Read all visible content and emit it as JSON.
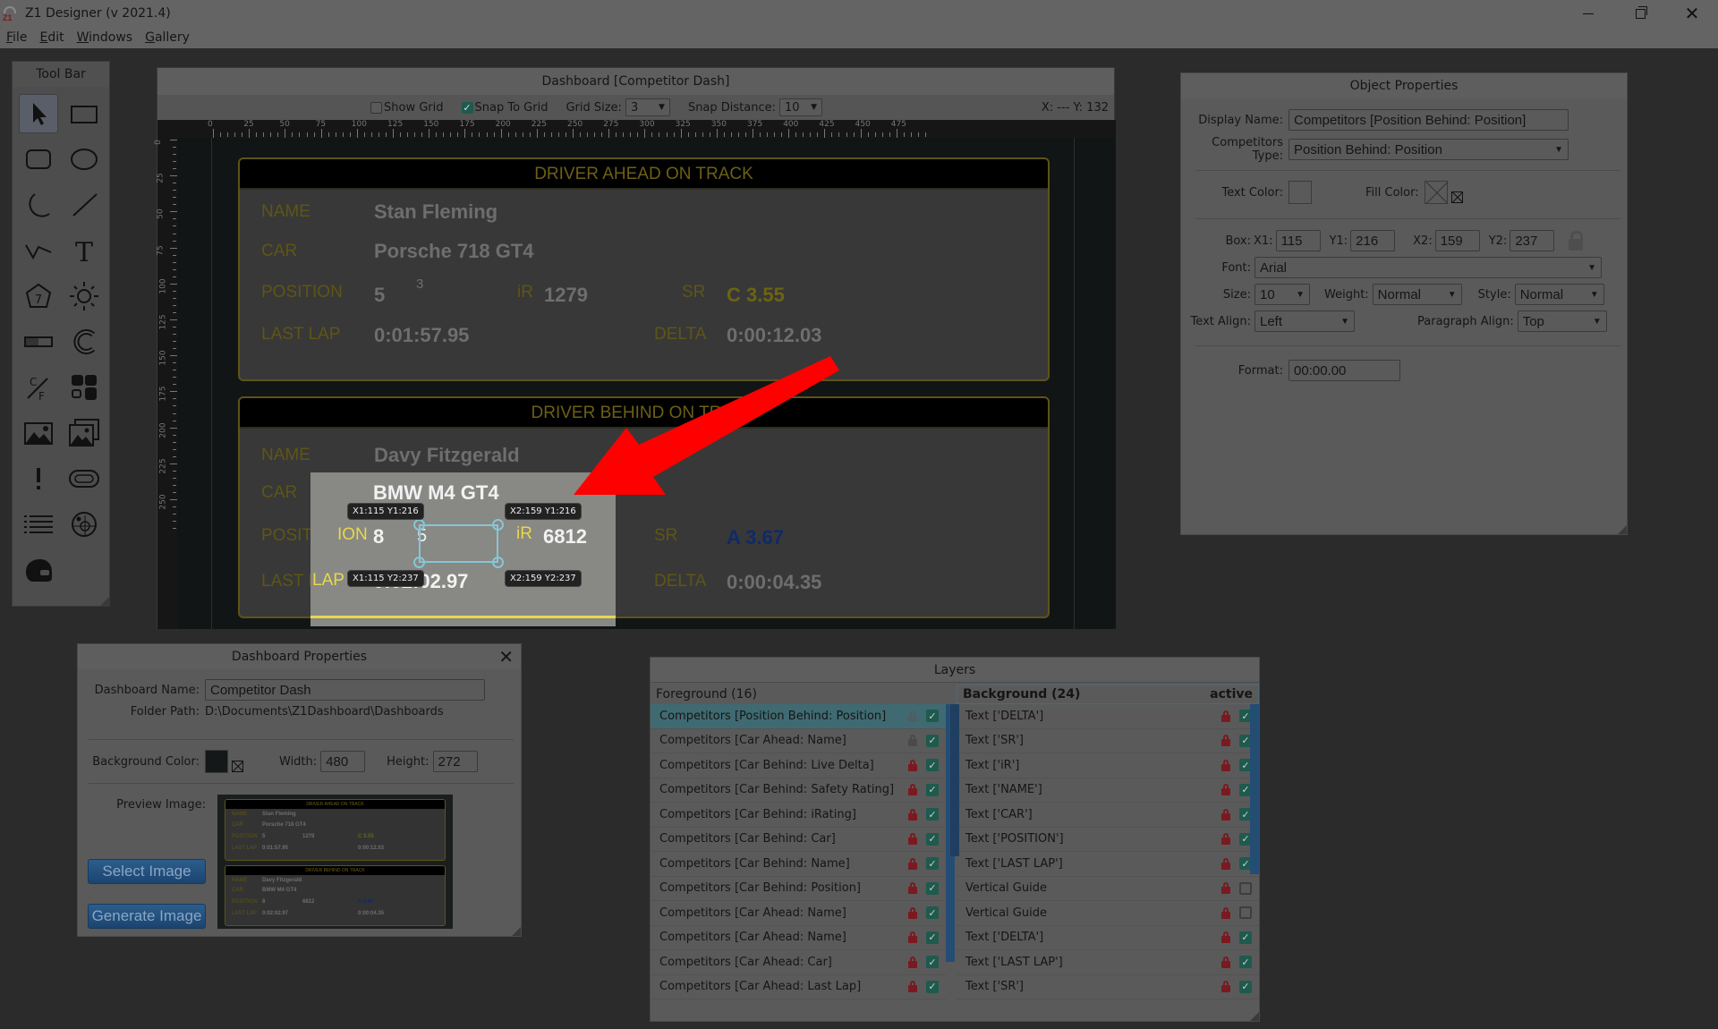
{
  "window": {
    "title": "Z1 Designer (v 2021.4)",
    "controls": [
      "minimize-icon",
      "restore-icon",
      "close-icon"
    ]
  },
  "menu": [
    {
      "label": "File",
      "accel": "F",
      "rest": "ile"
    },
    {
      "label": "Edit",
      "accel": "E",
      "rest": "dit"
    },
    {
      "label": "Windows",
      "accel": "W",
      "rest": "indows"
    },
    {
      "label": "Gallery",
      "accel": "G",
      "rest": "allery"
    }
  ],
  "toolbar": {
    "title": "Tool Bar",
    "tools": [
      "select",
      "rectangle",
      "rounded-rectangle",
      "ellipse",
      "arc",
      "line",
      "polyline",
      "text",
      "gear-indicator",
      "shift-light",
      "bar-gauge",
      "radial-gauge",
      "unit-converter",
      "widget-group",
      "image",
      "image-set",
      "alert",
      "track-map",
      "list",
      "target",
      "helmet"
    ],
    "selected": "select"
  },
  "editor": {
    "title": "Dashboard [Competitor Dash]",
    "show_grid_label": "Show Grid",
    "show_grid": false,
    "snap_to_grid_label": "Snap To Grid",
    "snap_to_grid": true,
    "grid_size_label": "Grid Size:",
    "grid_size": "3",
    "snap_distance_label": "Snap Distance:",
    "snap_distance": "10",
    "coords": "X: --- Y: 132",
    "ruler_x": [
      "0",
      "25",
      "50",
      "75",
      "100",
      "125",
      "150",
      "175",
      "200",
      "225",
      "250",
      "275",
      "300",
      "325",
      "350",
      "375",
      "400",
      "425",
      "450",
      "475"
    ],
    "ruler_y": [
      "0",
      "25",
      "50",
      "75",
      "100",
      "125",
      "150",
      "175",
      "200",
      "225",
      "250"
    ]
  },
  "dashboard": {
    "ahead": {
      "header": "DRIVER AHEAD ON TRACK",
      "name_label": "NAME",
      "name": "Stan Fleming",
      "car_label": "CAR",
      "car": "Porsche 718 GT4",
      "position_label": "POSITION",
      "position": "5",
      "position_class": "3",
      "ir_label": "iR",
      "ir": "1279",
      "sr_label": "SR",
      "sr": "C 3.55",
      "lastlap_label": "LAST LAP",
      "lastlap": "0:01:57.95",
      "delta_label": "DELTA",
      "delta": "0:00:12.03"
    },
    "behind": {
      "header": "DRIVER BEHIND ON TRACK",
      "name_label": "NAME",
      "name": "Davy Fitzgerald",
      "car_label": "CAR",
      "car": "BMW M4 GT4",
      "position_label": "POSITION",
      "position": "8",
      "position_class": "5",
      "ir_label": "iR",
      "ir": "6812",
      "sr_label": "SR",
      "sr": "A 3.67",
      "lastlap_label": "LAST LAP",
      "lastlap": "0:02:02.97",
      "delta_label": "DELTA",
      "delta": "0:00:04.35"
    },
    "selection_tips": {
      "tl": "X1:115 Y1:216",
      "tr": "X2:159 Y1:216",
      "bl": "X1:115 Y2:237",
      "br": "X2:159 Y2:237"
    }
  },
  "object_properties": {
    "title": "Object Properties",
    "display_name_label": "Display Name:",
    "display_name": "Competitors [Position Behind: Position]",
    "competitors_type_label": "Competitors Type:",
    "competitors_type": "Position Behind: Position",
    "text_color_label": "Text Color:",
    "fill_color_label": "Fill Color:",
    "box_label": "Box:",
    "x1_label": "X1:",
    "x1": "115",
    "y1_label": "Y1:",
    "y1": "216",
    "x2_label": "X2:",
    "x2": "159",
    "y2_label": "Y2:",
    "y2": "237",
    "font_label": "Font:",
    "font": "Arial",
    "size_label": "Size:",
    "size": "10",
    "weight_label": "Weight:",
    "weight": "Normal",
    "style_label": "Style:",
    "style": "Normal",
    "text_align_label": "Text Align:",
    "text_align": "Left",
    "paragraph_align_label": "Paragraph Align:",
    "paragraph_align": "Top",
    "format_label": "Format:",
    "format": "00:00.00"
  },
  "dashboard_properties": {
    "title": "Dashboard Properties",
    "name_label": "Dashboard Name:",
    "name": "Competitor Dash",
    "folder_label": "Folder Path:",
    "folder": "D:\\Documents\\Z1Dashboard\\Dashboards",
    "bg_color_label": "Background Color:",
    "bg_color": "#151819",
    "width_label": "Width:",
    "width": "480",
    "height_label": "Height:",
    "height": "272",
    "preview_label": "Preview Image:",
    "select_image": "Select Image",
    "generate_image": "Generate Image"
  },
  "layers": {
    "title": "Layers",
    "foreground": {
      "label": "Foreground (16)",
      "items": [
        {
          "label": "Competitors [Position Behind: Position]",
          "locked": false,
          "visible": true,
          "selected": true
        },
        {
          "label": "Competitors [Car Ahead: Name]",
          "locked": false,
          "visible": true
        },
        {
          "label": "Competitors [Car Behind: Live Delta]",
          "locked": true,
          "visible": true
        },
        {
          "label": "Competitors [Car Behind: Safety Rating]",
          "locked": true,
          "visible": true
        },
        {
          "label": "Competitors [Car Behind: iRating]",
          "locked": true,
          "visible": true
        },
        {
          "label": "Competitors [Car Behind: Car]",
          "locked": true,
          "visible": true
        },
        {
          "label": "Competitors [Car Behind: Name]",
          "locked": true,
          "visible": true
        },
        {
          "label": "Competitors [Car Behind: Position]",
          "locked": true,
          "visible": true
        },
        {
          "label": "Competitors [Car Ahead: Name]",
          "locked": true,
          "visible": true
        },
        {
          "label": "Competitors [Car Ahead: Name]",
          "locked": true,
          "visible": true
        },
        {
          "label": "Competitors [Car Ahead: Car]",
          "locked": true,
          "visible": true
        },
        {
          "label": "Competitors [Car Ahead: Last Lap]",
          "locked": true,
          "visible": true
        }
      ]
    },
    "background": {
      "label": "Background (24)",
      "active_label": "active",
      "items": [
        {
          "label": "Text ['DELTA']",
          "locked": true,
          "visible": true
        },
        {
          "label": "Text ['SR']",
          "locked": true,
          "visible": true
        },
        {
          "label": "Text ['iR']",
          "locked": true,
          "visible": true
        },
        {
          "label": "Text ['NAME']",
          "locked": true,
          "visible": true
        },
        {
          "label": "Text ['CAR']",
          "locked": true,
          "visible": true
        },
        {
          "label": "Text ['POSITION']",
          "locked": true,
          "visible": true
        },
        {
          "label": "Text ['LAST LAP']",
          "locked": true,
          "visible": true
        },
        {
          "label": "Vertical Guide",
          "locked": true,
          "visible": false
        },
        {
          "label": "Vertical Guide",
          "locked": true,
          "visible": false
        },
        {
          "label": "Text ['DELTA']",
          "locked": true,
          "visible": true
        },
        {
          "label": "Text ['LAST LAP']",
          "locked": true,
          "visible": true
        },
        {
          "label": "Text ['SR']",
          "locked": true,
          "visible": true
        }
      ]
    }
  }
}
